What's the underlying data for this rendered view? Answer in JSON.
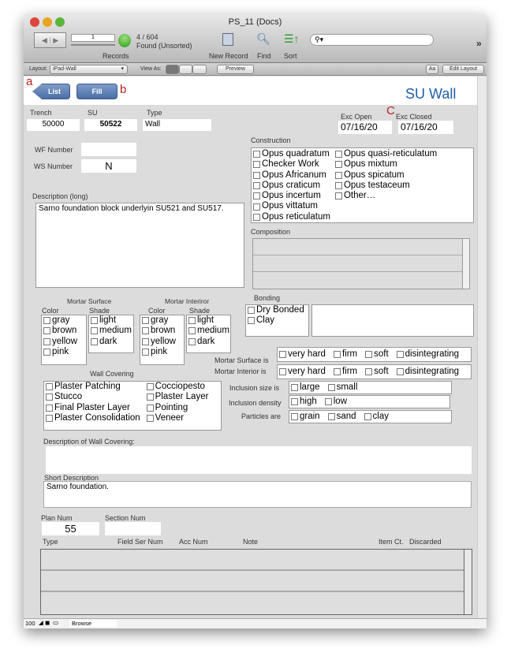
{
  "window": {
    "title": "PS_11 (Docs)"
  },
  "toolbar": {
    "record_number": "1",
    "record_count": "4 / 604",
    "found_status": "Found (Unsorted)",
    "records_label": "Records",
    "new_record_label": "New Record",
    "find_label": "Find",
    "sort_label": "Sort",
    "search_placeholder": "",
    "overflow": "»"
  },
  "layoutbar": {
    "layout_label": "Layout:",
    "layout_value": "iPad-Wall",
    "view_as_label": "View As:",
    "preview_label": "Preview",
    "text_format": "Aa",
    "edit_layout_label": "Edit Layout"
  },
  "header": {
    "annot_a": "a",
    "annot_b": "b",
    "annot_c": "C",
    "list_label": "List",
    "fill_label": "Fill",
    "title": "SU Wall"
  },
  "fields": {
    "trench_label": "Trench",
    "trench": "50000",
    "su_label": "SU",
    "su": "50522",
    "type_label": "Type",
    "type": "Wall",
    "exc_open_label": "Exc Open",
    "exc_open": "07/16/20",
    "exc_closed_label": "Exc Closed",
    "exc_closed": "07/16/20",
    "wf_label": "WF Number",
    "wf": "",
    "ws_label": "WS Number",
    "ws": "N",
    "desc_long_label": "Description (long)",
    "desc_long": "Sarno foundation block underlyin SU521 and SU517.",
    "construction_label": "Construction",
    "composition_label": "Composition",
    "mortar_surface_label": "Mortar Surface",
    "mortar_interior_label": "Mortar Interiror",
    "color_label": "Color",
    "shade_label": "Shade",
    "bonding_label": "Bonding",
    "mortar_surface_is_label": "Mortar Surface is",
    "mortar_interior_is_label": "Mortar Interior is",
    "wall_covering_label": "Wall Covering",
    "inclusion_size_label": "Inclusion size is",
    "inclusion_density_label": "Inclusion density",
    "particles_label": "Particles are",
    "desc_wall_covering_label": "Description of Wall Covering:",
    "desc_wall_covering": "",
    "short_desc_label": "Short Description",
    "short_desc": "Sarno foundation.",
    "plan_num_label": "Plan Num",
    "plan_num": "55",
    "section_num_label": "Section Num",
    "section_num": ""
  },
  "lists": {
    "construction_col1": [
      "Opus quadratum",
      "Checker Work",
      "Opus Africanum",
      "Opus craticum",
      "Opus incertum",
      "Opus vittatum",
      "Opus reticulatum"
    ],
    "construction_col2": [
      "Opus quasi-reticulatum",
      "Opus mixtum",
      "Opus spicatum",
      "Opus testaceum",
      "Other…"
    ],
    "colors": [
      "gray",
      "brown",
      "yellow",
      "pink"
    ],
    "shades": [
      "light",
      "medium",
      "dark"
    ],
    "bonding": [
      "Dry Bonded",
      "Clay"
    ],
    "hardness": [
      "very hard",
      "firm",
      "soft",
      "disintegrating"
    ],
    "wall_covering_col1": [
      "Plaster Patching",
      "Stucco",
      "Final Plaster Layer",
      "Plaster Consolidation"
    ],
    "wall_covering_col2": [
      "Cocciopesto",
      "Plaster Layer",
      "Pointing",
      "Veneer"
    ],
    "inclusion_size": [
      "large",
      "small"
    ],
    "inclusion_density": [
      "high",
      "low"
    ],
    "particles": [
      "grain",
      "sand",
      "clay"
    ]
  },
  "portal": {
    "columns": [
      "Type",
      "Field Ser Num",
      "Acc Num",
      "Note",
      "Item Ct.",
      "Discarded"
    ]
  },
  "status": {
    "zoom": "100",
    "mode": "Browse"
  },
  "colors": {
    "title_blue": "#1f5fa8",
    "annotation_red": "#b22222",
    "button_blue": "#5a7db3"
  }
}
